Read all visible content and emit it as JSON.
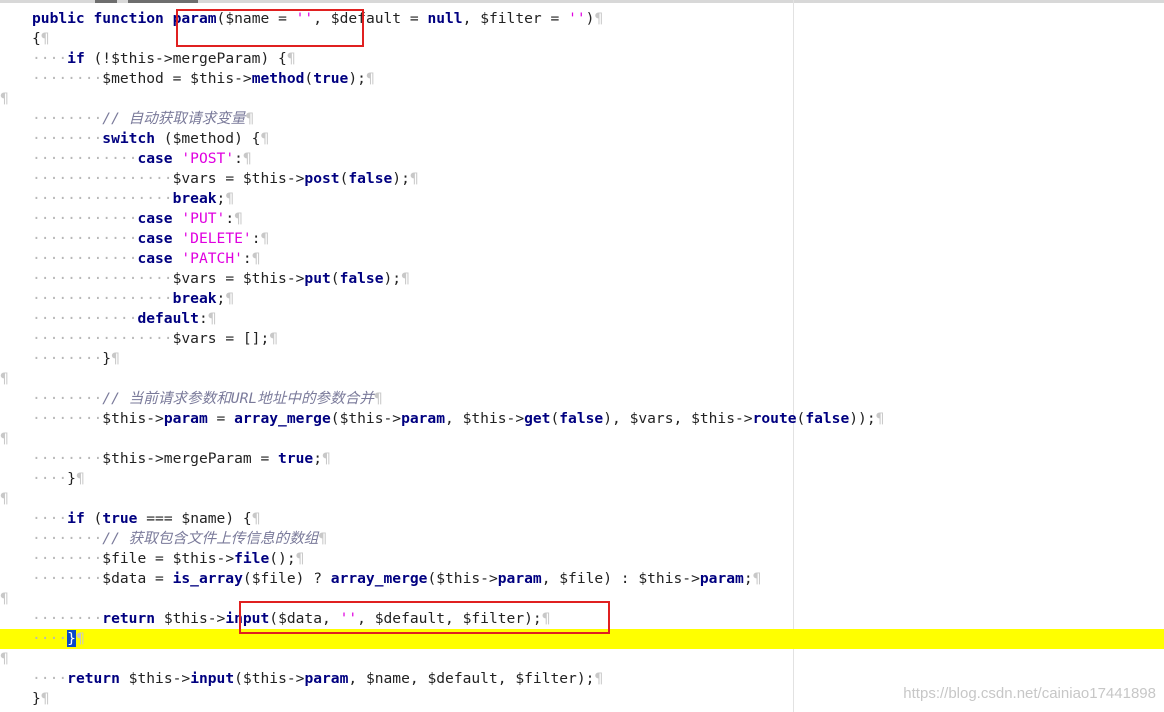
{
  "editor": {
    "lines": [
      "public function param($name = '', $default = null, $filter = '')",
      "{",
      "    if (!$this->mergeParam) {",
      "        $method = $this->method(true);",
      "",
      "        // 自动获取请求变量",
      "        switch ($method) {",
      "            case 'POST':",
      "                $vars = $this->post(false);",
      "                break;",
      "            case 'PUT':",
      "            case 'DELETE':",
      "            case 'PATCH':",
      "                $vars = $this->put(false);",
      "                break;",
      "            default:",
      "                $vars = [];",
      "        }",
      "",
      "        // 当前请求参数和URL地址中的参数合并",
      "        $this->param = array_merge($this->param, $this->get(false), $vars, $this->route(false));",
      "",
      "        $this->mergeParam = true;",
      "    }",
      "",
      "    if (true === $name) {",
      "        // 获取包含文件上传信息的数组",
      "        $file = $this->file();",
      "        $data = is_array($file) ? array_merge($this->param, $file) : $this->param;",
      "",
      "        return $this->input($data, '', $default, $filter);",
      "    }",
      "",
      "    return $this->input($this->param, $name, $default, $filter);",
      "}"
    ],
    "highlighted_line": 31,
    "pilcrow": "¶"
  },
  "watermark": "https://blog.csdn.net/cainiao17441898"
}
